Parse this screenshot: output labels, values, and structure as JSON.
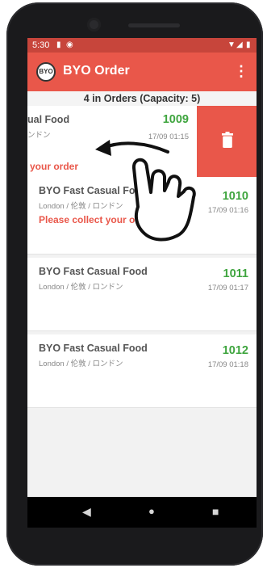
{
  "status_bar": {
    "time": "5:30"
  },
  "app_bar": {
    "logo_text": "BYO",
    "title": "BYO Order",
    "menu_icon": "more-vert-icon"
  },
  "summary": {
    "text": "4 in Orders (Capacity: 5)"
  },
  "orders": [
    {
      "name": "BYO Fast Casual Food",
      "visible_name": "ual Food",
      "location": "London / 伦敦 / ロンドン",
      "visible_location": "ンドン",
      "number": "1009",
      "time": "17/09 01:15",
      "message": "Please collect your order",
      "visible_message": "your order"
    },
    {
      "name": "BYO Fast Casual Food",
      "visible_name": "BYO Fast Casual Foo",
      "location": "London / 伦敦 / ロンドン",
      "number": "1010",
      "time": "17/09 01:16",
      "message": "Please collect your order"
    },
    {
      "name": "BYO Fast Casual Food",
      "location": "London / 伦敦 / ロンドン",
      "number": "1011",
      "time": "17/09 01:17"
    },
    {
      "name": "BYO Fast Casual Food",
      "location": "London / 伦敦 / ロンドン",
      "number": "1012",
      "time": "17/09 01:18"
    }
  ],
  "swipe_action": {
    "icon": "trash-icon"
  },
  "gesture_hint": {
    "icon": "swipe-left-hand-icon"
  },
  "nav_bar": {
    "back_icon": "back-triangle-icon",
    "home_icon": "home-circle-icon",
    "recents_icon": "recents-square-icon"
  },
  "colors": {
    "primary": "#e9574a",
    "status_bar": "#c7453b",
    "accent_green": "#3fa53f",
    "text_gray": "#555555"
  }
}
